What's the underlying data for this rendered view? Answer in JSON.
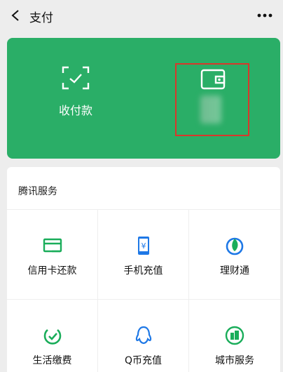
{
  "header": {
    "title": "支付"
  },
  "card": {
    "scan_label": "收付款"
  },
  "services": {
    "section_title": "腾讯服务",
    "items": [
      {
        "label": "信用卡还款",
        "icon": "credit-card-icon"
      },
      {
        "label": "手机充值",
        "icon": "phone-topup-icon"
      },
      {
        "label": "理财通",
        "icon": "wealth-icon"
      },
      {
        "label": "生活缴费",
        "icon": "bill-pay-icon"
      },
      {
        "label": "Q币充值",
        "icon": "qq-coin-icon"
      },
      {
        "label": "城市服务",
        "icon": "city-service-icon"
      }
    ]
  },
  "colors": {
    "brand_green": "#2aae67",
    "icon_green": "#1aad5a",
    "icon_blue": "#1e78e6",
    "highlight_red": "#d9372b"
  }
}
